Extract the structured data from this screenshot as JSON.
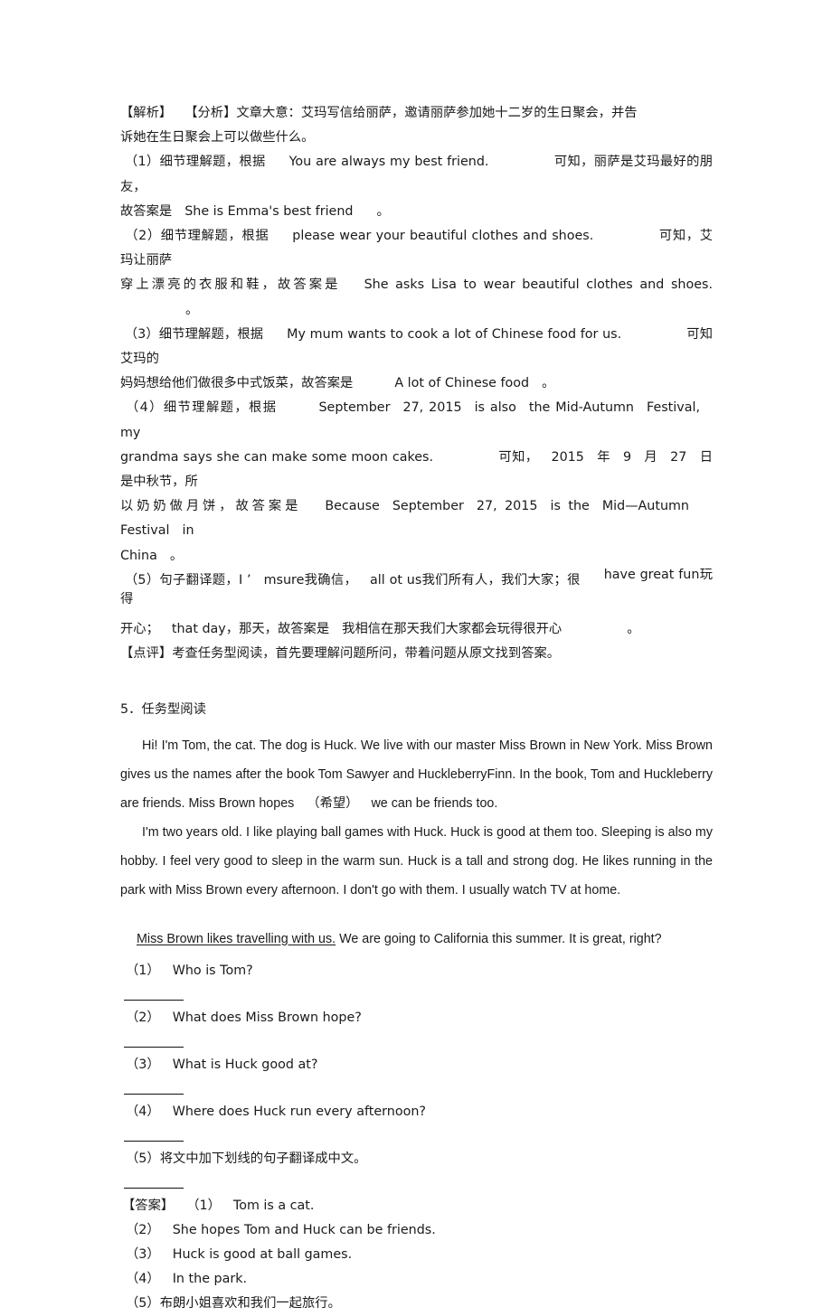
{
  "document": {
    "explanation": {
      "label_jiexi": "【解析】",
      "label_fenxi": "【分析】",
      "summary_line1": "文章大意：艾玛写信给丽萨，邀请丽萨参加她十二岁的生日聚会，并告",
      "summary_line2": "诉她在生日聚会上可以做些什么。",
      "items": [
        {
          "num": "（1）",
          "type": "细节理解题，根据",
          "quote": "You are always my best friend.",
          "deduce": "可知，丽萨是艾玛最好的朋友，",
          "answer_lead": "故答案是",
          "answer": "She is Emma's best friend",
          "period": "。"
        },
        {
          "num": "（2）",
          "type": "细节理解题，根据",
          "quote": "please wear your beautiful clothes and shoes.",
          "deduce": "可知，艾玛让丽萨",
          "deduce2": "穿上漂亮的衣服和鞋，故答案是",
          "answer": "She asks Lisa to wear beautiful clothes and shoes.",
          "period": "。"
        },
        {
          "num": "（3）",
          "type": "细节理解题，根据",
          "quote": "My mum wants to cook a lot of Chinese food for us.",
          "deduce": "可知艾玛的",
          "deduce2": "妈妈想给他们做很多中式饭菜，故答案是",
          "answer": "A lot of Chinese food",
          "period": "。"
        },
        {
          "num": "（4）",
          "type": "细节理解题，根据",
          "quote_a": "September",
          "quote_b": "27, 2015",
          "quote_c": "is also",
          "quote_d": "the Mid-Autumn",
          "quote_e": "Festival,",
          "quote_f": "my",
          "quote_g": "grandma says she can make some moon cakes.",
          "deduce": "可知，",
          "deduce_year": "2015",
          "deduce_nian": "年",
          "deduce_month": "9",
          "deduce_yue": "月",
          "deduce_day": "27",
          "deduce_rest": "日是中秋节，所",
          "deduce2": "以奶奶做月饼，故答案是",
          "ans_a": "Because",
          "ans_b": "September",
          "ans_c": "27, 2015",
          "ans_d": "is the",
          "ans_e": "Mid—Autumn",
          "ans_f": "Festival",
          "ans_g": "in",
          "ans_h": "China",
          "period": "。"
        },
        {
          "num": "（5）",
          "type": "句子翻译题，",
          "t1": "I ’",
          "t2": "msure",
          "t3": "我确信，",
          "t4": "all ot us",
          "t5": "我们所有人，我们大家；很",
          "t6": "have great fun",
          "t7": "玩得",
          "t8": "开心；",
          "t9": "that day",
          "t10": "，那天，故答案是",
          "answer": "我相信在那天我们大家都会玩得很开心",
          "period": "。"
        }
      ],
      "dianping_label": "【点评】",
      "dianping_text": "考查任务型阅读，首先要理解问题所问，带着问题从原文找到答案。"
    },
    "section5": {
      "heading": "5．任务型阅读",
      "passage": {
        "para1": "Hi! I'm Tom, the cat. The dog is Huck. We live with our master Miss Brown in New York. Miss Brown gives us the names after the book Tom Sawyer and HuckleberryFinn. In the book, Tom and Huckleberry are friends. Miss Brown hopes",
        "para1_gloss": "（希望）",
        "para1_tail": "we can be friends too.",
        "para2": "I'm two years old. I like playing ball games with Huck. Huck is good at them too. Sleeping is also my hobby. I feel very good to sleep in the warm sun. Huck is a tall and strong dog. He likes running in the park with Miss Brown every afternoon. I don't go with them. I usually watch TV at home.",
        "para3_underlined": "Miss Brown likes travelling with us.",
        "para3_rest": "We are going to California this summer. It is great, right?"
      },
      "questions": [
        {
          "num": "（1）",
          "text": "Who is Tom?"
        },
        {
          "num": "（2）",
          "text": "What does Miss Brown hope?"
        },
        {
          "num": "（3）",
          "text": "What is Huck good at?"
        },
        {
          "num": "（4）",
          "text": "Where does Huck run every afternoon?"
        },
        {
          "num": "（5）",
          "text": "将文中加下划线的句子翻译成中文。"
        }
      ],
      "answers": {
        "label": "【答案】",
        "items": [
          {
            "num": "（1）",
            "text": "Tom is a cat."
          },
          {
            "num": "（2）",
            "text": "She hopes Tom and Huck can be friends."
          },
          {
            "num": "（3）",
            "text": "Huck is good at ball games."
          },
          {
            "num": "（4）",
            "text": "In the park."
          },
          {
            "num": "（5）",
            "text": "布朗小姐喜欢和我们一起旅行。"
          }
        ]
      }
    }
  }
}
